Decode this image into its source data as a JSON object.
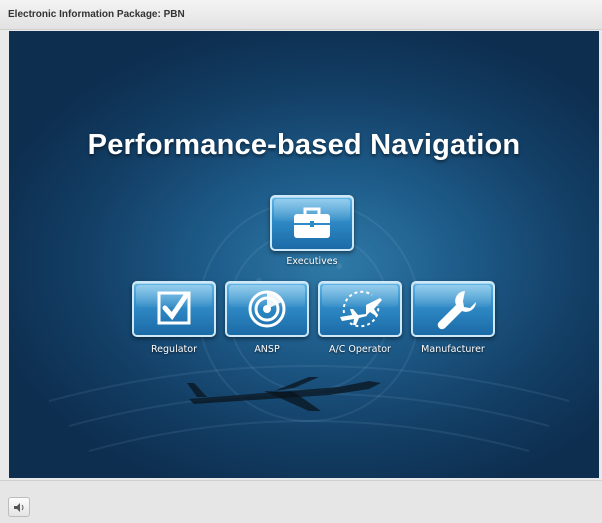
{
  "window": {
    "title": "Electronic Information Package: PBN"
  },
  "stage": {
    "headline": "Performance-based Navigation",
    "tiles": [
      {
        "label": "Executives",
        "icon": "briefcase-icon"
      },
      {
        "label": "Regulator",
        "icon": "checkbox-icon"
      },
      {
        "label": "ANSP",
        "icon": "radar-icon"
      },
      {
        "label": "A/C Operator",
        "icon": "aircraft-route-icon"
      },
      {
        "label": "Manufacturer",
        "icon": "wrench-icon"
      }
    ]
  },
  "controls": {
    "audio_icon": "speaker-icon"
  },
  "colors": {
    "stage_dark": "#0d2e4f",
    "stage_light": "#2f7aa8",
    "tile_blue": "#2f8ac6"
  }
}
